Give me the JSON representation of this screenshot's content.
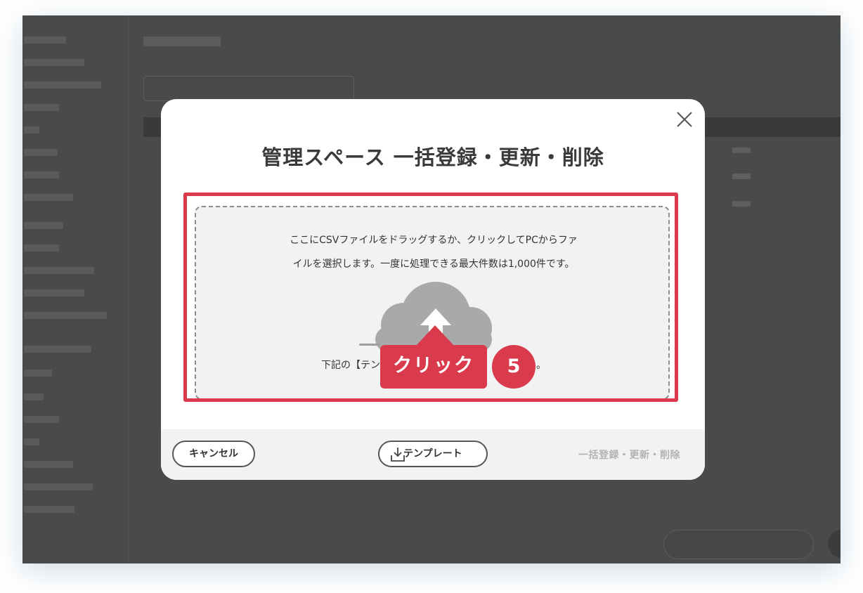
{
  "modal": {
    "title": "管理スペース 一括登録・更新・削除",
    "dropzone": {
      "line1": "ここにCSVファイルをドラッグするか、クリックしてPCからファ",
      "line2": "イルを選択します。一度に処理できる最大件数は1,000件です。",
      "sub_left": "下記の【テン",
      "sub_right": "。"
    },
    "annotation": {
      "label": "クリック",
      "step": "5"
    },
    "footer": {
      "cancel": "キャンセル",
      "template": "テンプレート",
      "submit": "一括登録・更新・削除"
    }
  },
  "icons": {
    "close": "close-icon",
    "cloud": "cloud-upload-icon",
    "download": "download-icon"
  },
  "colors": {
    "accent": "#d93a4c",
    "overlay": "#4a4a4a",
    "dropzone_bg": "#f2f2f2",
    "disabled_text": "#b3b3b3"
  }
}
